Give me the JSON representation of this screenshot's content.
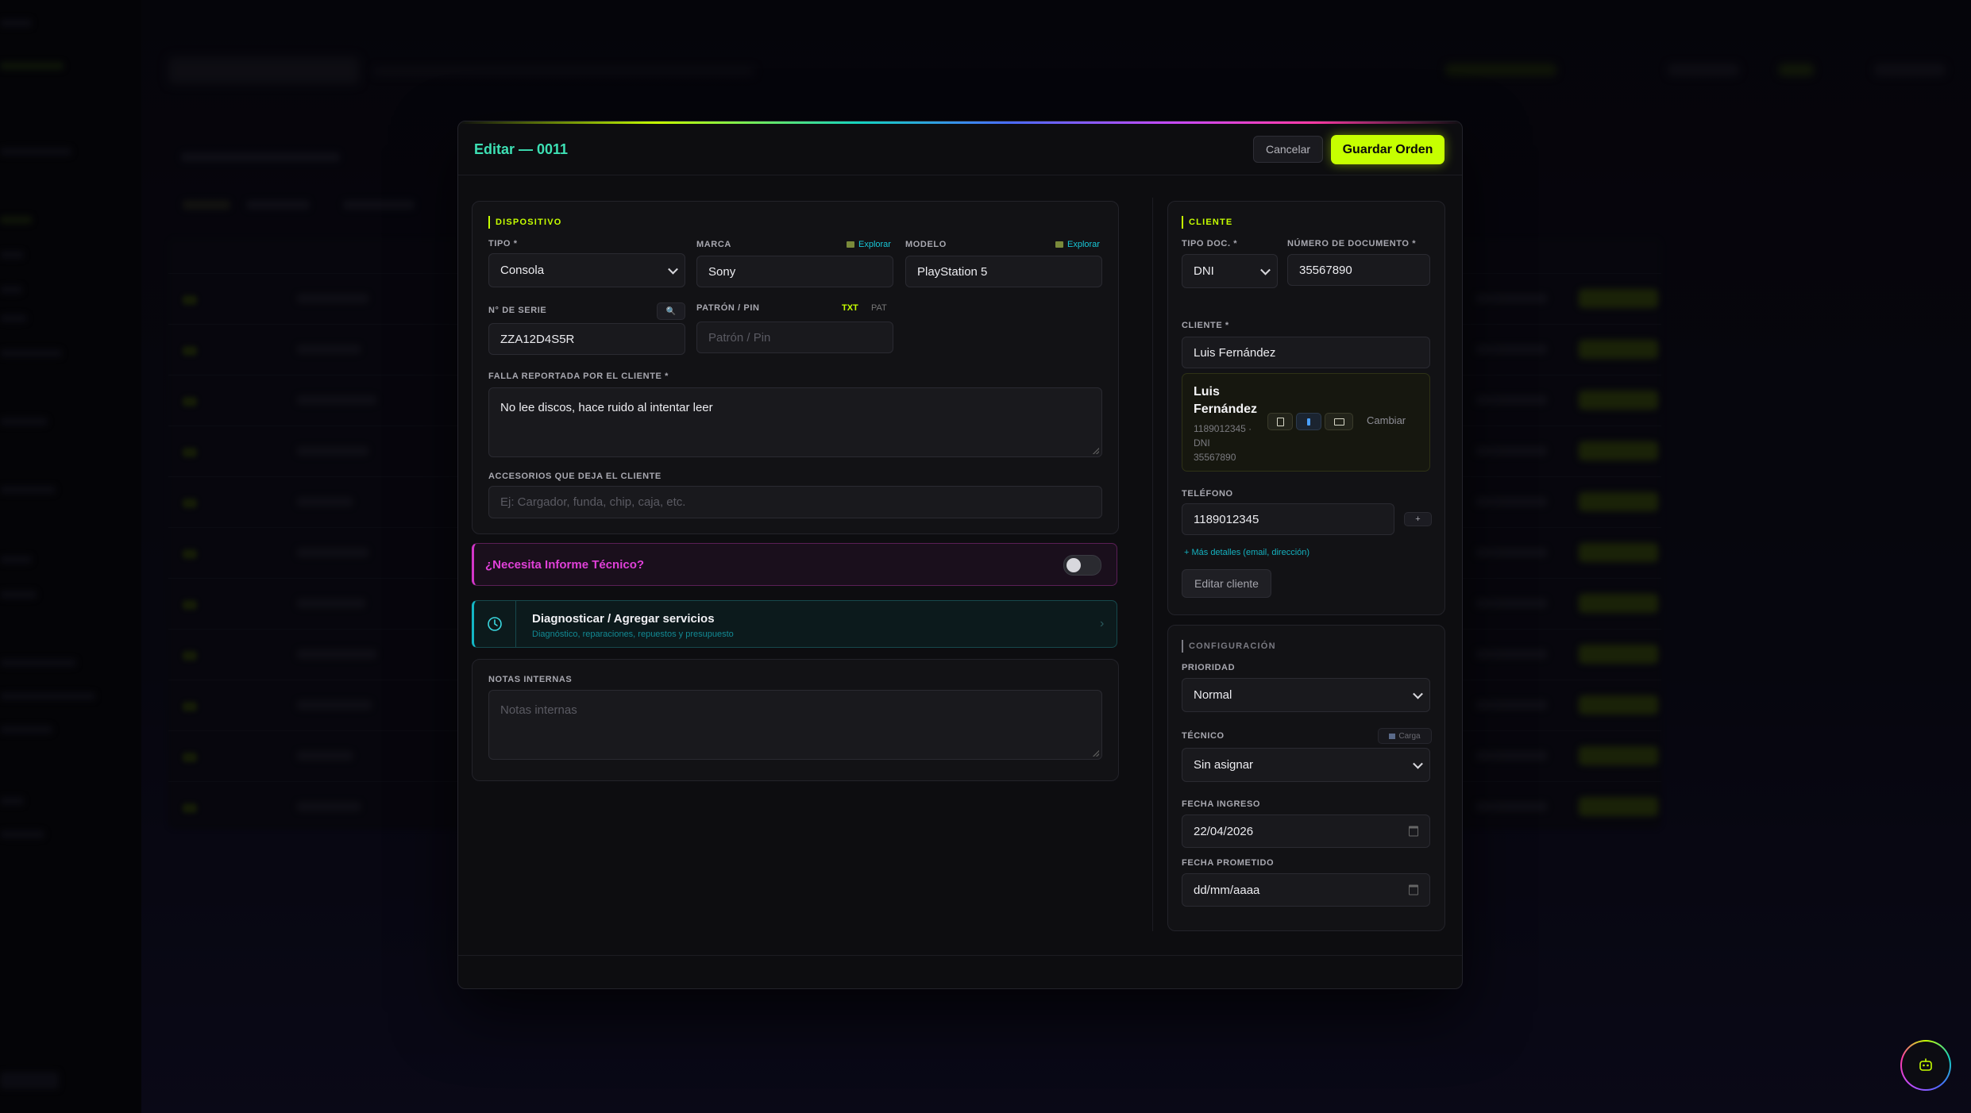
{
  "modal": {
    "title": "Editar — 0011",
    "cancel_label": "Cancelar",
    "save_label": "Guardar Orden"
  },
  "device": {
    "section_title": "DISPOSITIVO",
    "tipo_label": "TIPO *",
    "tipo_value": "Consola",
    "marca_label": "MARCA",
    "marca_value": "Sony",
    "modelo_label": "MODELO",
    "modelo_value": "PlayStation 5",
    "explore_label": "Explorar",
    "serie_label": "N° DE SERIE",
    "serie_value": "ZZA12D4S5R",
    "pin_label": "PATRÓN / PIN",
    "pin_placeholder": "Patrón / Pin",
    "pin_mode_txt": "TXT",
    "pin_mode_pat": "PAT",
    "falla_label": "FALLA REPORTADA POR EL CLIENTE *",
    "falla_value": "No lee discos, hace ruido al intentar leer",
    "accesorios_label": "ACCESORIOS QUE DEJA EL CLIENTE",
    "accesorios_placeholder": "Ej: Cargador, funda, chip, caja, etc."
  },
  "informe": {
    "question": "¿Necesita Informe Técnico?",
    "enabled": false
  },
  "diagnostico": {
    "title": "Diagnosticar / Agregar servicios",
    "subtitle": "Diagnóstico, reparaciones, repuestos y presupuesto"
  },
  "notas": {
    "label": "NOTAS INTERNAS",
    "placeholder": "Notas internas"
  },
  "cliente": {
    "section_title": "CLIENTE",
    "tipo_doc_label": "TIPO DOC. *",
    "tipo_doc_value": "DNI",
    "num_doc_label": "NÚMERO DE DOCUMENTO *",
    "num_doc_value": "35567890",
    "cliente_label": "CLIENTE *",
    "cliente_value": "Luis Fernández",
    "card_first_name": "Luis",
    "card_last_name": "Fernández",
    "card_phone_line": "1189012345 ·",
    "card_doc_type": "DNI",
    "card_doc_number": "35567890",
    "cambiar_label": "Cambiar",
    "telefono_label": "TELÉFONO",
    "telefono_value": "1189012345",
    "add_phone_label": "+",
    "mas_detalles_label": "+ Más detalles (email, dirección)",
    "editar_label": "Editar cliente"
  },
  "config": {
    "section_title": "CONFIGURACIÓN",
    "prioridad_label": "PRIORIDAD",
    "prioridad_value": "Normal",
    "tecnico_label": "TÉCNICO",
    "carga_label": "Carga",
    "tecnico_value": "Sin asignar",
    "fecha_ingreso_label": "FECHA INGRESO",
    "fecha_ingreso_value": "22/04/2026",
    "fecha_prometido_label": "FECHA PROMETIDO",
    "fecha_prometido_value": "dd/mm/aaaa"
  },
  "colors": {
    "accent": "#c6ff00",
    "title_teal": "#3de0b4",
    "link_cyan": "#18c6d6",
    "informe_magenta": "#e040d8"
  }
}
